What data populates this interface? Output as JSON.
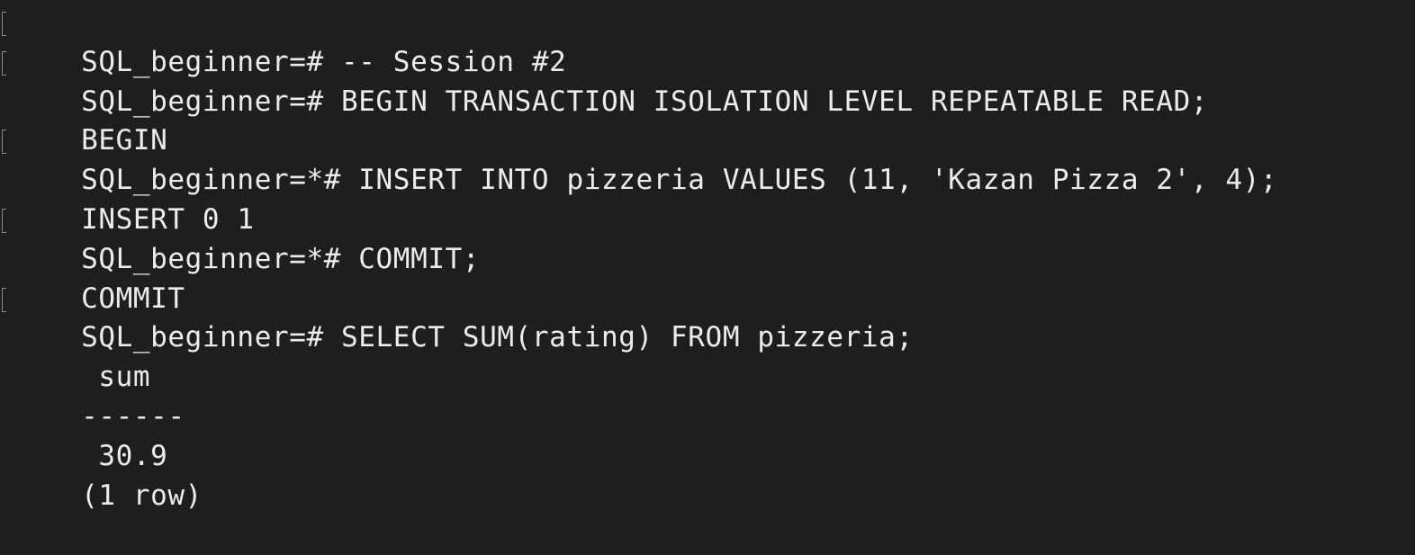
{
  "terminal": {
    "colors": {
      "background": "#1e1e1e",
      "text": "#ececec",
      "marker": "#8a8a8a"
    },
    "lines": [
      {
        "text": "SQL_beginner=# -- Session #2",
        "prompt": true
      },
      {
        "text": "SQL_beginner=# BEGIN TRANSACTION ISOLATION LEVEL REPEATABLE READ;",
        "prompt": true
      },
      {
        "text": "BEGIN",
        "prompt": false
      },
      {
        "text": "SQL_beginner=*# INSERT INTO pizzeria VALUES (11, 'Kazan Pizza 2', 4);",
        "prompt": true
      },
      {
        "text": "INSERT 0 1",
        "prompt": false
      },
      {
        "text": "SQL_beginner=*# COMMIT;",
        "prompt": true
      },
      {
        "text": "COMMIT",
        "prompt": false
      },
      {
        "text": "SQL_beginner=# SELECT SUM(rating) FROM pizzeria;",
        "prompt": true
      },
      {
        "text": " sum",
        "prompt": false
      },
      {
        "text": "------",
        "prompt": false
      },
      {
        "text": " 30.9",
        "prompt": false
      },
      {
        "text": "(1 row)",
        "prompt": false
      }
    ]
  }
}
